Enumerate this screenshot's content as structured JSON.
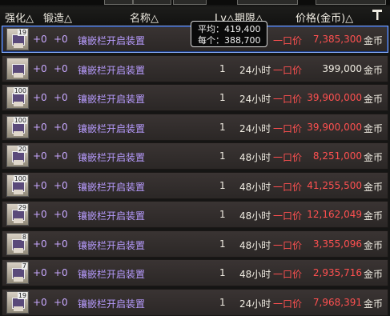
{
  "header": {
    "enhance": "强化△",
    "forge": "锻造△",
    "name": "名称△",
    "lv_dur": "Lv△期限△",
    "price": "价格(金币)△"
  },
  "tooltip": {
    "avg": "平均：419,400",
    "each": "每个：388,700"
  },
  "rows": [
    {
      "stack": "19",
      "enhance": "+0",
      "forge": "+0",
      "name": "镶嵌栏开启装置",
      "level": "",
      "duration": "",
      "type": "一口价",
      "price": "7,385,300",
      "currency": "金币"
    },
    {
      "stack": "",
      "enhance": "+0",
      "forge": "+0",
      "name": "镶嵌栏开启装置",
      "level": "1",
      "duration": "24小时",
      "type": "一口价",
      "price": "399,000",
      "currency": "金币"
    },
    {
      "stack": "100",
      "enhance": "+0",
      "forge": "+0",
      "name": "镶嵌栏开启装置",
      "level": "1",
      "duration": "24小时",
      "type": "一口价",
      "price": "39,900,000",
      "currency": "金币"
    },
    {
      "stack": "100",
      "enhance": "+0",
      "forge": "+0",
      "name": "镶嵌栏开启装置",
      "level": "1",
      "duration": "24小时",
      "type": "一口价",
      "price": "39,900,000",
      "currency": "金币"
    },
    {
      "stack": "20",
      "enhance": "+0",
      "forge": "+0",
      "name": "镶嵌栏开启装置",
      "level": "1",
      "duration": "48小时",
      "type": "一口价",
      "price": "8,251,000",
      "currency": "金币"
    },
    {
      "stack": "100",
      "enhance": "+0",
      "forge": "+0",
      "name": "镶嵌栏开启装置",
      "level": "1",
      "duration": "48小时",
      "type": "一口价",
      "price": "41,255,500",
      "currency": "金币"
    },
    {
      "stack": "29",
      "enhance": "+0",
      "forge": "+0",
      "name": "镶嵌栏开启装置",
      "level": "1",
      "duration": "48小时",
      "type": "一口价",
      "price": "12,162,049",
      "currency": "金币"
    },
    {
      "stack": "8",
      "enhance": "+0",
      "forge": "+0",
      "name": "镶嵌栏开启装置",
      "level": "1",
      "duration": "48小时",
      "type": "一口价",
      "price": "3,355,096",
      "currency": "金币"
    },
    {
      "stack": "7",
      "enhance": "+0",
      "forge": "+0",
      "name": "镶嵌栏开启装置",
      "level": "1",
      "duration": "48小时",
      "type": "一口价",
      "price": "2,935,716",
      "currency": "金币"
    },
    {
      "stack": "19",
      "enhance": "+0",
      "forge": "+0",
      "name": "镶嵌栏开启装置",
      "level": "1",
      "duration": "24小时",
      "type": "一口价",
      "price": "7,968,391",
      "currency": "金币"
    }
  ],
  "colors": {
    "price_red": "#ff5050",
    "name_purple": "#b89cff",
    "selection_blue": "#8ab0ff"
  },
  "icons": {
    "item": "socket-opener-item-icon",
    "header_tool": "hammer-icon"
  }
}
